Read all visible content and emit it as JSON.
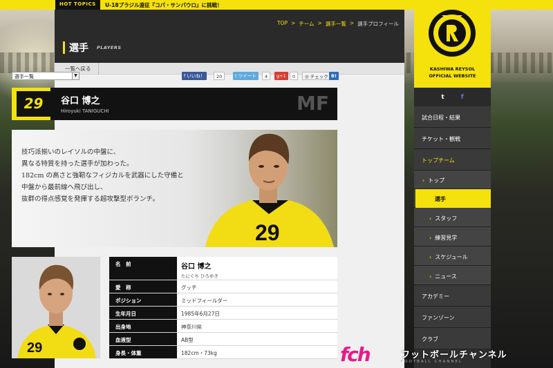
{
  "topics": {
    "tag": "HOT TOPICS",
    "news": "U-18ブラジル遠征『コパ・サンパウロ』に挑戦！"
  },
  "breadcrumb": {
    "items": [
      "TOP",
      "チーム",
      "選手一覧"
    ],
    "current": "選手プロフィール",
    "sep": ">"
  },
  "page_title": {
    "ja": "選手",
    "en": "PLAYERS"
  },
  "back_link": "一覧へ戻る",
  "player_select": "選手一覧",
  "share": {
    "fb_label": "いいね！",
    "fb_count": "20",
    "tw_label": "ツイート",
    "tw_count": "4",
    "gplus_label": "g+1",
    "gplus_count": "0",
    "check_label": "チェック",
    "b_label": "B!"
  },
  "player": {
    "number": "29",
    "name_ja": "谷口 博之",
    "name_en": "Hiroyuki TANIGUCHI",
    "position_code": "MF",
    "copy": [
      "技巧派揃いのレイソルの中盤に、",
      "異なる特質を持った選手が加わった。",
      "182cm の高さと強靭なフィジカルを武器にした守備と",
      "中盤から最前線へ飛び出し、",
      "抜群の得点感覚を発揮する超攻撃型ボランチ。"
    ]
  },
  "profile_table": {
    "name_label": "名　前",
    "name_value": "谷口 博之",
    "name_kana": "たにぐち ひろゆき",
    "rows": [
      {
        "label": "愛　称",
        "value": "グッチ"
      },
      {
        "label": "ポジション",
        "value": "ミッドフィールダー"
      },
      {
        "label": "生年月日",
        "value": "1985年6月27日"
      },
      {
        "label": "出身地",
        "value": "神奈川県"
      },
      {
        "label": "血液型",
        "value": "AB型"
      },
      {
        "label": "身長・体重",
        "value": "182cm・73kg"
      }
    ]
  },
  "sidebar": {
    "logo_text": "KASHIWA REYSOL OFFICIAL WEBSITE",
    "logo_line1": "KASHIWA REYSOL",
    "logo_line2": "OFFICIAL WEBSITE",
    "social": {
      "twitter": "t",
      "facebook": "f"
    },
    "nav": [
      {
        "label": "試合日程・結果"
      },
      {
        "label": "チケット・観戦"
      },
      {
        "label": "トップチーム"
      },
      {
        "label": "トップ"
      },
      {
        "label": "選手"
      },
      {
        "label": "スタッフ"
      },
      {
        "label": "練習見学"
      },
      {
        "label": "スケジュール"
      },
      {
        "label": "ニュース"
      },
      {
        "label": "アカデミー"
      },
      {
        "label": "ファンゾーン"
      },
      {
        "label": "クラブ"
      }
    ]
  },
  "watermark": {
    "mark": "fch",
    "text": "フットボールチャンネル",
    "sub": "FOOTBALL CHANNEL"
  },
  "colors": {
    "accent": "#f5e10c",
    "dark": "#121212",
    "pink": "#e81a8a"
  }
}
